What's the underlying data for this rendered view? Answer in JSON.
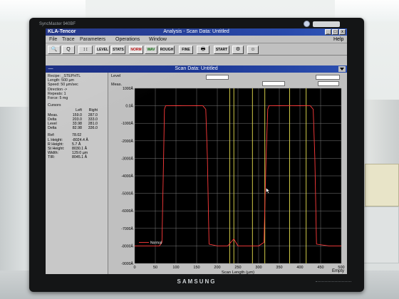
{
  "monitor": {
    "model_label": "SyncMaster 940BF",
    "brand": "SAMSUNG"
  },
  "window": {
    "app_name": "KLA-Tencor",
    "title": "Analysis - Scan Data: Untitled",
    "buttons": [
      "_",
      "□",
      "x"
    ]
  },
  "menu": {
    "items": [
      "File",
      "Trace",
      "Parameters",
      "Operations",
      "Window"
    ],
    "help": "Help"
  },
  "toolbar": {
    "buttons": [
      {
        "label": "🔍",
        "name": "zoom-icon"
      },
      {
        "label": "Q",
        "name": "magnify-icon"
      },
      {
        "label": "↕↕",
        "name": "scale-icon"
      },
      {
        "label": "LEVEL",
        "name": "level"
      },
      {
        "label": "STATS",
        "name": "stats"
      },
      {
        "label": "NORM",
        "name": "norm"
      },
      {
        "label": "WAV",
        "name": "wav"
      },
      {
        "label": "ROUGH",
        "name": "rough"
      },
      {
        "label": "FINE",
        "name": "fine"
      },
      {
        "label": "🖶",
        "name": "printer-icon"
      },
      {
        "label": "START",
        "name": "start"
      },
      {
        "label": "⚙",
        "name": "settings-icon"
      },
      {
        "label": "☺",
        "name": "smiley-icon"
      }
    ]
  },
  "scan_window": {
    "title": "Scan Data: Untitled",
    "status": "Empty"
  },
  "info": {
    "recipe": "Recipe: _STEPHTL",
    "length": "Length: 500 µm",
    "speed": "Speed: 50 µm/sec",
    "direction": "Direction ->",
    "repeats": "Repeats: 1",
    "force": "Force: 5 mg",
    "cursors_title": "Cursors",
    "cursor_headers": [
      "",
      "Left",
      "Right"
    ],
    "cursor_rows": [
      [
        "Meas.",
        "159.0",
        "287.0"
      ],
      [
        "Delta",
        "203.0",
        "333.0"
      ],
      [
        "Level",
        "33.98",
        "281.0"
      ],
      [
        "Delta",
        "82.98",
        "336.0"
      ]
    ],
    "measurements": [
      [
        "Ref:",
        "78.02"
      ],
      [
        "L Height:",
        "-8024.4 Å"
      ],
      [
        "R Height:",
        "5.7 Å"
      ],
      [
        "St Height:",
        "8030.1 Å"
      ],
      [
        "Width:",
        "129.0 µm"
      ],
      [
        "TIR:",
        "8045.1 Å"
      ]
    ]
  },
  "plot_labels": {
    "level": "Level",
    "meas": "Meas."
  },
  "chart_data": {
    "type": "line",
    "xlabel": "Scan Length (µm)",
    "ylabel": "",
    "xlim": [
      0,
      500
    ],
    "ylim": [
      -9000,
      1000
    ],
    "x_ticks": [
      0,
      50,
      100,
      150,
      200,
      250,
      300,
      350,
      400,
      450,
      500
    ],
    "y_ticks": [
      {
        "v": 1000,
        "label": "1000Å"
      },
      {
        "v": 0,
        "label": "0.0Å"
      },
      {
        "v": -1000,
        "label": "-1000Å"
      },
      {
        "v": -2000,
        "label": "-2000Å"
      },
      {
        "v": -3000,
        "label": "-3000Å"
      },
      {
        "v": -4000,
        "label": "-4000Å"
      },
      {
        "v": -5000,
        "label": "-5000Å"
      },
      {
        "v": -6000,
        "label": "-6000Å"
      },
      {
        "v": -7000,
        "label": "-7000Å"
      },
      {
        "v": -8000,
        "label": "-8000Å"
      },
      {
        "v": -9000,
        "label": "-9000Å"
      }
    ],
    "grid": true,
    "legend": "Normal",
    "series": [
      {
        "name": "Normal",
        "color": "#ff3b3b",
        "x": [
          0,
          60,
          66,
          70,
          72,
          75,
          100,
          130,
          150,
          165,
          172,
          176,
          180,
          200,
          225,
          240,
          250,
          260,
          275,
          300,
          313,
          318,
          322,
          325,
          330,
          350,
          380,
          400,
          425,
          432,
          436,
          440,
          470,
          500
        ],
        "y": [
          -8000,
          -8000,
          -7800,
          -3000,
          -200,
          0,
          10,
          0,
          10,
          0,
          -200,
          -3000,
          -7900,
          -8000,
          -8000,
          -7600,
          -8000,
          -8000,
          -8000,
          -8000,
          -7800,
          -3000,
          -200,
          0,
          0,
          10,
          0,
          10,
          0,
          -200,
          -3000,
          -7900,
          -8000,
          -8000
        ]
      }
    ],
    "cursors": [
      {
        "x": 230,
        "color": "#e8e050"
      },
      {
        "x": 240,
        "color": "#e8e050"
      },
      {
        "x": 285,
        "color": "#e8e050"
      },
      {
        "x": 315,
        "color": "#e8e050"
      },
      {
        "x": 375,
        "color": "#e8e050"
      },
      {
        "x": 415,
        "color": "#e8e050"
      }
    ]
  }
}
